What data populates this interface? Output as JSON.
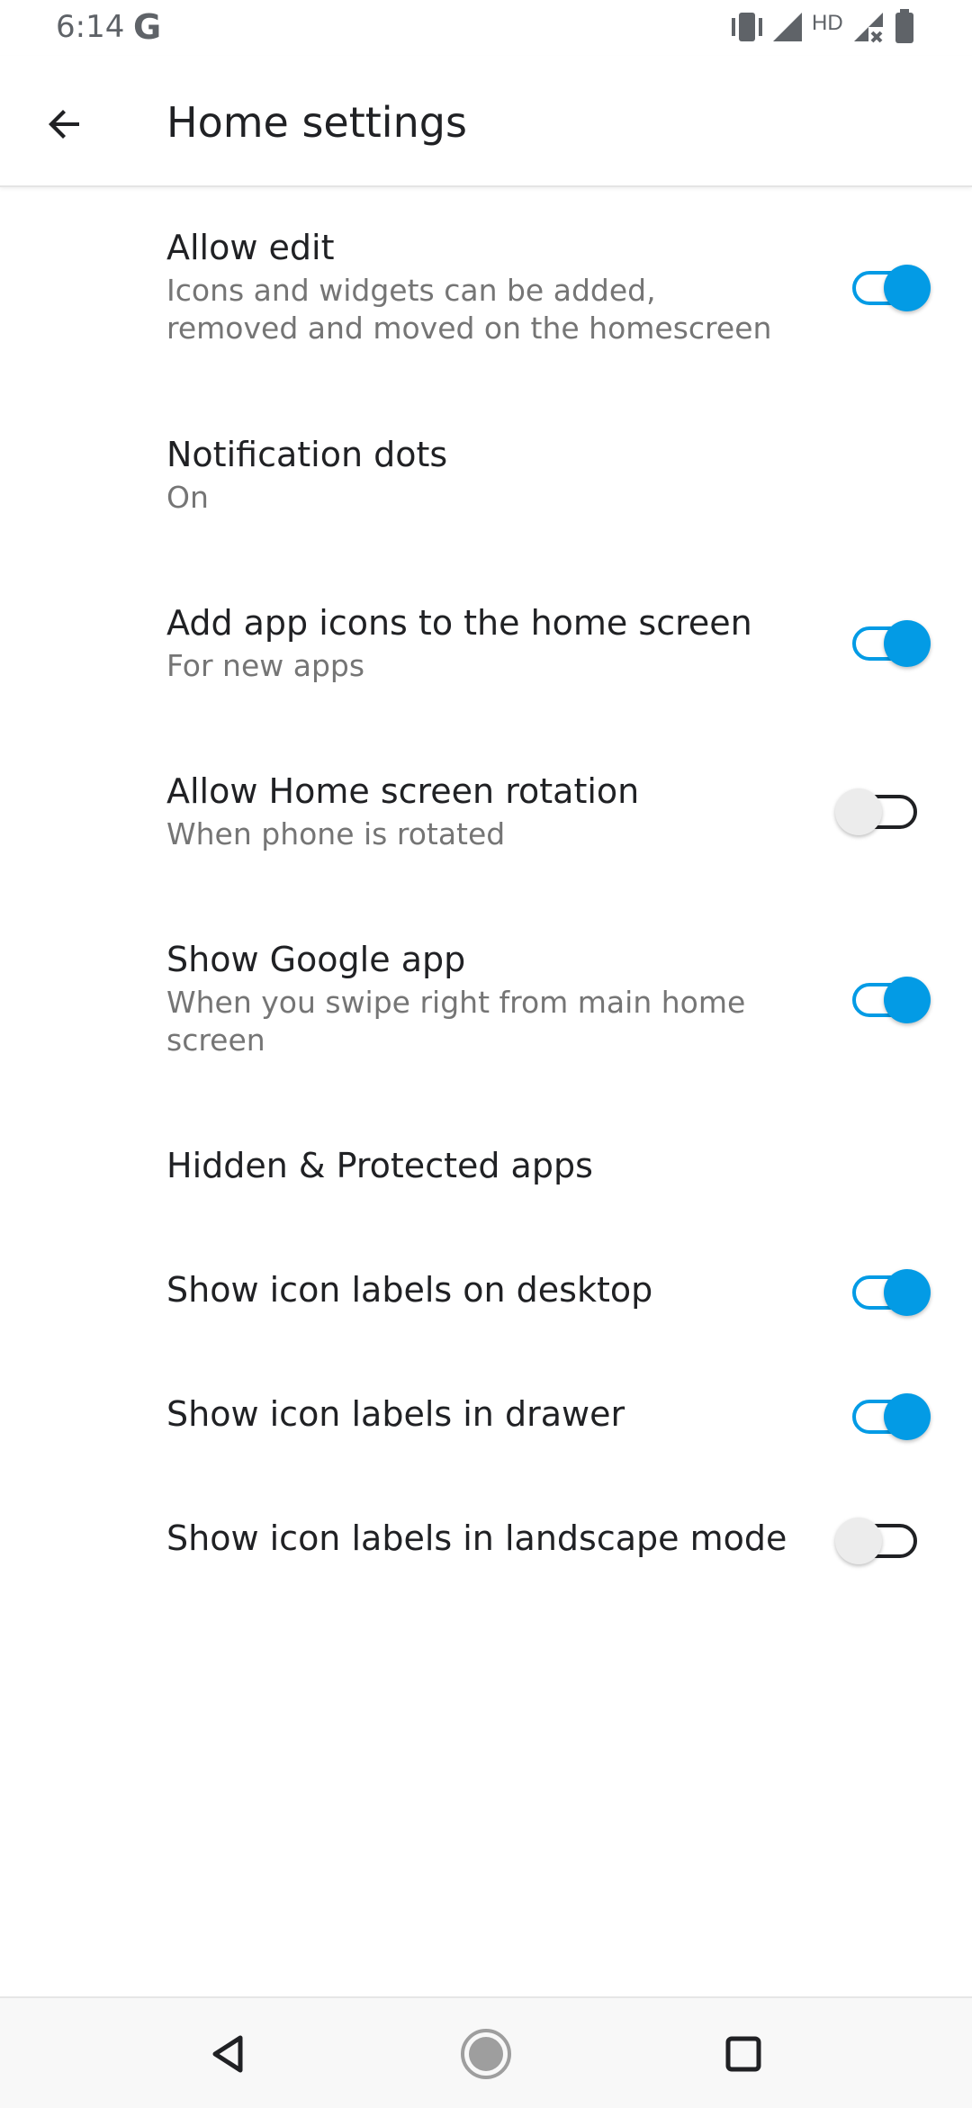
{
  "status_bar": {
    "time": "6:14",
    "google_badge": "G",
    "network_label": "HD",
    "icons": [
      "vibrate-icon",
      "signal-icon",
      "hd-label",
      "signal-no-data-icon",
      "battery-icon"
    ]
  },
  "app_bar": {
    "back_icon": "arrow-back-icon",
    "title": "Home settings"
  },
  "settings": [
    {
      "title": "Allow edit",
      "summary": "Icons and widgets can be added, removed and moved on the homescreen",
      "toggle": true
    },
    {
      "title": "Notification dots",
      "summary": "On",
      "toggle": null
    },
    {
      "title": "Add app icons to the home screen",
      "summary": "For new apps",
      "toggle": true
    },
    {
      "title": "Allow Home screen rotation",
      "summary": "When phone is rotated",
      "toggle": false
    },
    {
      "title": "Show Google app",
      "summary": "When you swipe right from main home screen",
      "toggle": true
    },
    {
      "title": "Hidden & Protected apps",
      "summary": "",
      "toggle": null
    },
    {
      "title": "Show icon labels on desktop",
      "summary": "",
      "toggle": true
    },
    {
      "title": "Show icon labels in drawer",
      "summary": "",
      "toggle": true
    },
    {
      "title": "Show icon labels in landscape mode",
      "summary": "",
      "toggle": false
    }
  ],
  "nav_bar": {
    "buttons": [
      "back-triangle-icon",
      "home-circle-icon",
      "recents-square-icon"
    ]
  },
  "colors": {
    "accent": "#039be5",
    "text_primary": "#202124",
    "text_secondary": "#757575",
    "divider": "#e4e4e4",
    "nav_background": "#f8f8f8"
  }
}
